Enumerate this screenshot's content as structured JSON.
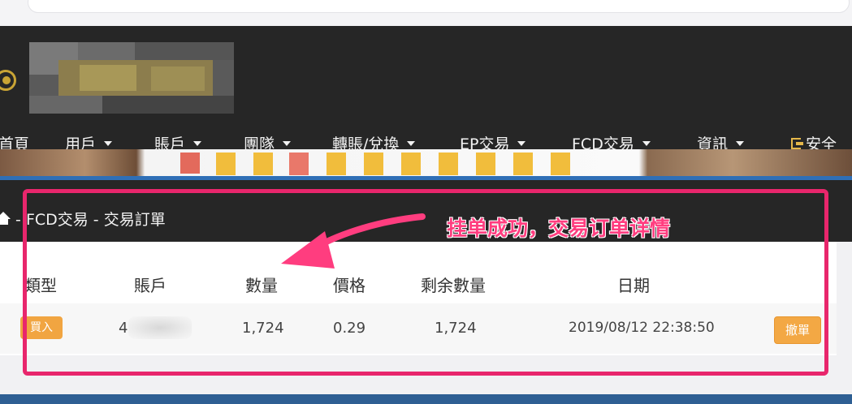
{
  "nav": {
    "items": [
      {
        "label": "首頁"
      },
      {
        "label": "用戶"
      },
      {
        "label": "賬戶"
      },
      {
        "label": "團隊"
      },
      {
        "label": "轉賬/兌換"
      },
      {
        "label": "EP交易"
      },
      {
        "label": "FCD交易"
      },
      {
        "label": "資訊"
      }
    ],
    "logout_label": "安全"
  },
  "breadcrumb": {
    "text": "- FCD交易 - 交易訂單"
  },
  "table": {
    "headers": [
      "類型",
      "賬戶",
      "數量",
      "價格",
      "剩余數量",
      "日期"
    ],
    "row": {
      "type": "買入",
      "account": "4",
      "quantity": "1,724",
      "price": "0.29",
      "remaining": "1,724",
      "date": "2019/08/12 22:38:50",
      "action": "撤單"
    }
  },
  "annotation": {
    "text": "挂单成功，交易订单详情",
    "color": "#ff3d7f"
  },
  "colors": {
    "header_bg": "#262626",
    "accent": "#f1a541",
    "annotation_frame": "#e8266c"
  }
}
